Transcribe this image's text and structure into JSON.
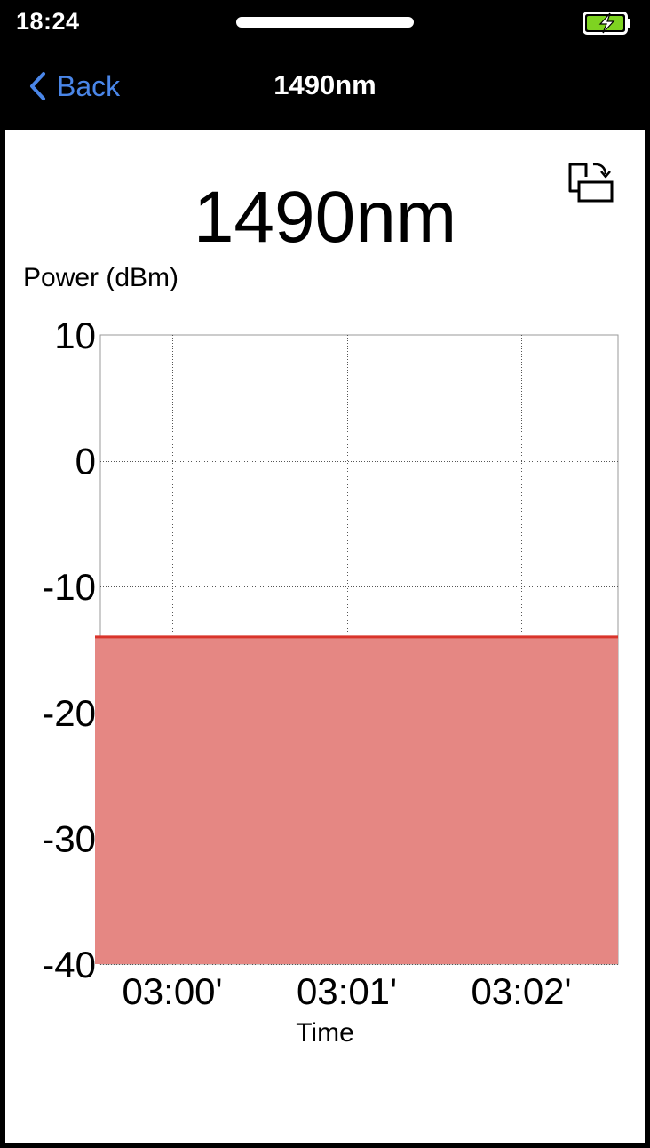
{
  "status_bar": {
    "time": "18:24",
    "battery_icon": "battery-charging-icon",
    "battery_color": "#7ed321"
  },
  "nav_bar": {
    "back_label": "Back",
    "title": "1490nm",
    "accent": "#4a86e8"
  },
  "page": {
    "heading": "1490nm",
    "rotate_icon": "rotate-screen-icon"
  },
  "chart_data": {
    "type": "area",
    "title": "",
    "ylabel": "Power (dBm)",
    "xlabel": "Time",
    "ylim": [
      -40,
      10
    ],
    "y_ticks": [
      "10",
      "0",
      "-10",
      "-20",
      "-30",
      "-40"
    ],
    "y_tick_values": [
      10,
      0,
      -10,
      -20,
      -30,
      -40
    ],
    "x_ticks": [
      "03:00'",
      "03:01'",
      "03:02'"
    ],
    "series": [
      {
        "values": [
          -14,
          -14,
          -14,
          -14
        ],
        "line_color": "#d9342b",
        "fill_color": "#e58783"
      }
    ],
    "grid": true
  }
}
